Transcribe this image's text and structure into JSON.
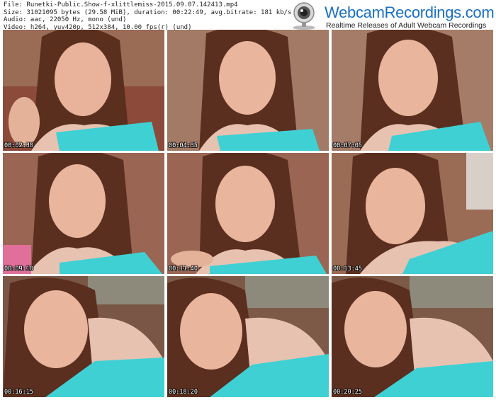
{
  "file_info": {
    "line1": "File: Runetki-Public.Show-f-xlittlemiss-2015.09.07.142413.mp4",
    "line2": "Size: 31021095 bytes (29.58 MiB), duration: 00:22:49, avg.bitrate: 181 kb/s",
    "line3": "Audio: aac, 22050 Hz, mono (und)",
    "line4": "Video: h264, yuv420p, 512x384, 10.00 fps(r) (und)"
  },
  "brand": {
    "name": "WebcamRecordings.com",
    "tagline": "Realtime Releases of Adult Webcam Recordings",
    "color": "#1a6fc4"
  },
  "thumbnails": [
    {
      "timestamp": "00:02:30"
    },
    {
      "timestamp": "00:04:35"
    },
    {
      "timestamp": "00:07:05"
    },
    {
      "timestamp": "00:09:10"
    },
    {
      "timestamp": "00:11:40"
    },
    {
      "timestamp": "00:13:45"
    },
    {
      "timestamp": "00:16:15"
    },
    {
      "timestamp": "00:18:20"
    },
    {
      "timestamp": "00:20:25"
    }
  ]
}
